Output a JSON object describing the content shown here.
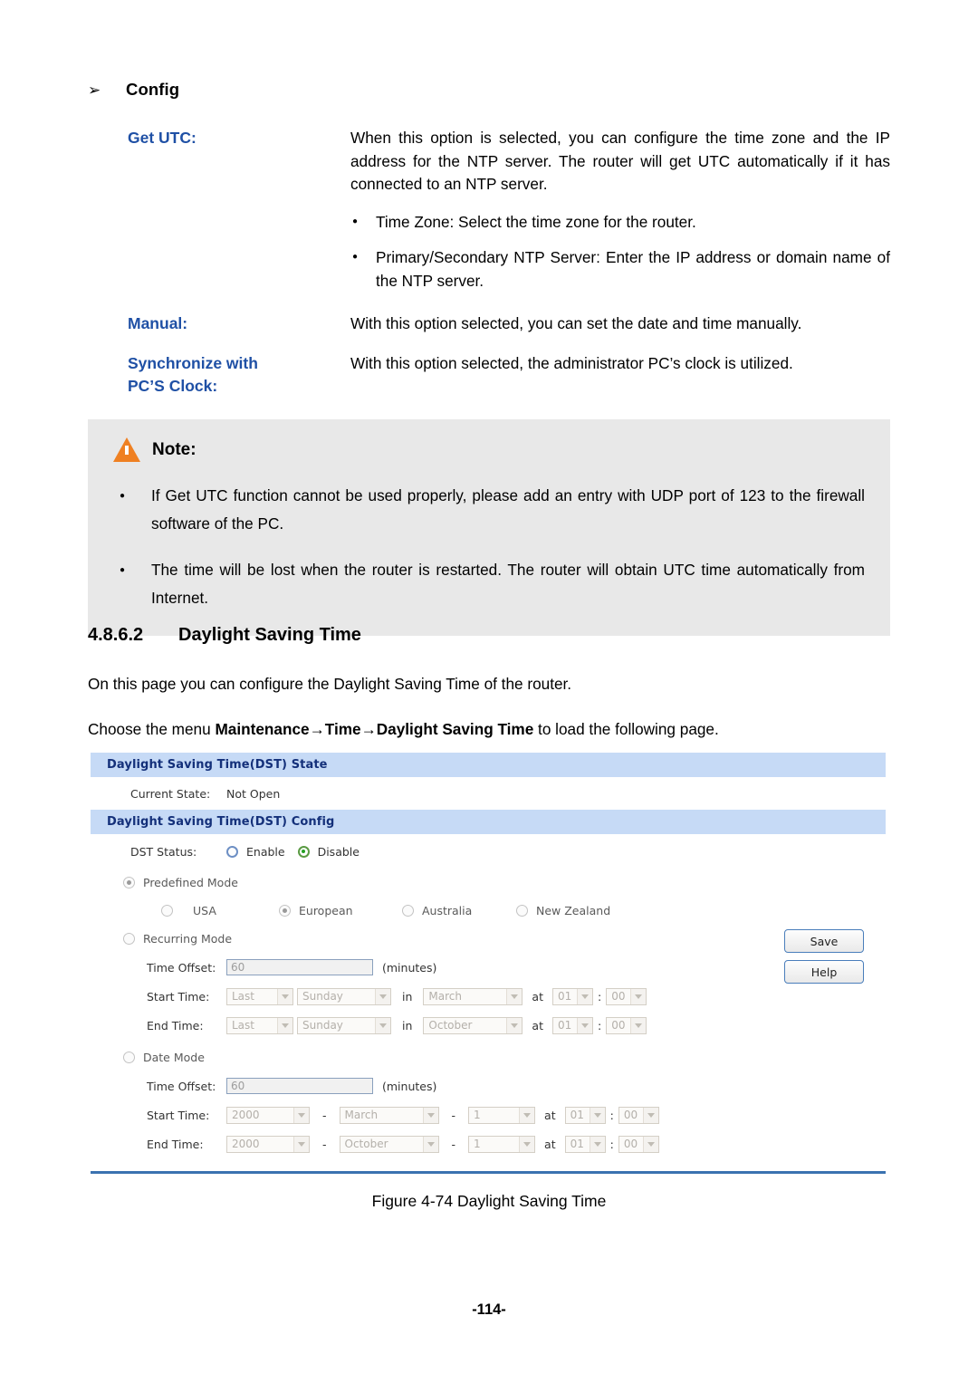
{
  "document": {
    "config_heading": "Config",
    "bullet_arrow": "➢",
    "definitions": [
      {
        "term": "Get UTC:",
        "paragraphs": [
          "When this option is selected, you can configure the time zone and the IP address for the NTP server. The router will get UTC automatically if it has connected to an NTP server."
        ],
        "bullets": [
          "Time Zone: Select the time zone for the router.",
          "Primary/Secondary NTP Server: Enter the IP address or domain name of the NTP server."
        ]
      },
      {
        "term": "Manual:",
        "paragraphs": [
          "With this option selected, you can set the date and time manually."
        ],
        "bullets": []
      },
      {
        "term": "Synchronize with PC’S Clock:",
        "term_line1": "Synchronize with",
        "term_line2": "PC’S Clock:",
        "paragraphs": [
          "With this option selected, the administrator PC’s clock is utilized."
        ],
        "bullets": []
      }
    ],
    "note": {
      "label": "Note:",
      "items": [
        "If Get UTC function cannot be used properly, please add an entry with UDP port of 123 to the firewall software of the PC.",
        "The time will be lost when the router is restarted. The router will obtain UTC time automatically from Internet."
      ]
    },
    "section": {
      "number": "4.8.6.2",
      "title": "Daylight Saving Time",
      "intro": "On this page you can configure the Daylight Saving Time of the router.",
      "menu_prefix": "Choose the menu ",
      "menu_path": "Maintenance→Time→Daylight Saving Time",
      "menu_suffix": " to load the following page."
    },
    "figure_caption": "Figure 4-74 Daylight Saving Time",
    "page_number": "-114-"
  },
  "ui": {
    "state_panel": {
      "header": "Daylight Saving Time(DST) State",
      "current_state_label": "Current State:",
      "current_state_value": "Not Open"
    },
    "config_panel": {
      "header": "Daylight Saving Time(DST) Config",
      "dst_status_label": "DST Status:",
      "dst_enable_label": "Enable",
      "dst_disable_label": "Disable",
      "predefined_mode_label": "Predefined Mode",
      "predefined_options": [
        "USA",
        "European",
        "Australia",
        "New Zealand"
      ],
      "predefined_selected": "European",
      "recurring_mode_label": "Recurring Mode",
      "date_mode_label": "Date Mode",
      "time_offset_label": "Time Offset:",
      "time_offset_value": "60",
      "time_offset_unit": "(minutes)",
      "start_time_label": "Start Time:",
      "end_time_label": "End Time:",
      "word_in": "in",
      "word_at": "at",
      "word_colon": ":",
      "word_dash": "-",
      "recurring": {
        "start": {
          "ordinal": "Last",
          "weekday": "Sunday",
          "month": "March",
          "hour": "01",
          "minute": "00"
        },
        "end": {
          "ordinal": "Last",
          "weekday": "Sunday",
          "month": "October",
          "hour": "01",
          "minute": "00"
        }
      },
      "date": {
        "start": {
          "year": "2000",
          "month": "March",
          "day": "1",
          "hour": "01",
          "minute": "00"
        },
        "end": {
          "year": "2000",
          "month": "October",
          "day": "1",
          "hour": "01",
          "minute": "00"
        }
      },
      "save_label": "Save",
      "help_label": "Help"
    },
    "colors": {
      "bar_background": "#c6daf6",
      "bar_text": "#14307a",
      "rule": "#3b72b0",
      "note_background": "#e8e8e8",
      "term_text": "#1f50a5",
      "warning": "#ef8022",
      "radio_on": "#23a123"
    }
  }
}
